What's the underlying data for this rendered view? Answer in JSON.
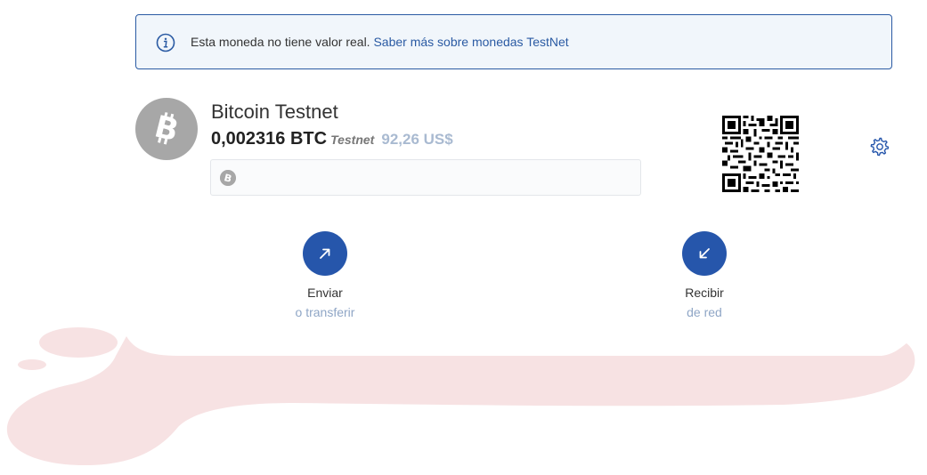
{
  "banner": {
    "text": "Esta moneda no tiene valor real.",
    "link": "Saber más sobre monedas TestNet"
  },
  "coin": {
    "name": "Bitcoin Testnet",
    "amount": "0,002316 BTC",
    "network_tag": "Testnet",
    "fiat": "92,26 US$"
  },
  "address": {
    "value": ""
  },
  "actions": {
    "send": {
      "label": "Enviar",
      "sub": "o transferir"
    },
    "receive": {
      "label": "Recibir",
      "sub": "de red"
    }
  },
  "icons": {
    "info": "info-circle-icon",
    "coin": "bitcoin-icon",
    "qr": "qr-code-icon",
    "settings": "gear-icon",
    "send": "arrow-up-right-icon",
    "receive": "arrow-down-left-icon"
  },
  "colors": {
    "accent": "#2656ab",
    "banner_bg": "#f1f6fb",
    "coin_gray": "#a7a7a7",
    "blob": "#f7e2e3"
  }
}
